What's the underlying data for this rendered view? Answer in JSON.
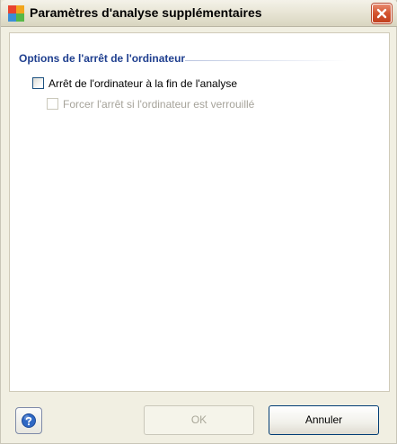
{
  "window": {
    "title": "Paramètres d'analyse supplémentaires",
    "icon": "avg-logo-icon",
    "close_icon": "close-icon"
  },
  "section": {
    "title": "Options de l'arrêt de l'ordinateur"
  },
  "options": [
    {
      "label": "Arrêt de l'ordinateur à la fin de l'analyse",
      "checked": false,
      "enabled": true
    },
    {
      "label": "Forcer l'arrêt si l'ordinateur est verrouillé",
      "checked": false,
      "enabled": false
    }
  ],
  "footer": {
    "help_icon": "help-icon",
    "ok_label": "OK",
    "ok_enabled": false,
    "cancel_label": "Annuler"
  },
  "colors": {
    "section_title": "#1f3f8f",
    "close_button": "#d3532e",
    "dialog_background": "#f1efe2"
  }
}
